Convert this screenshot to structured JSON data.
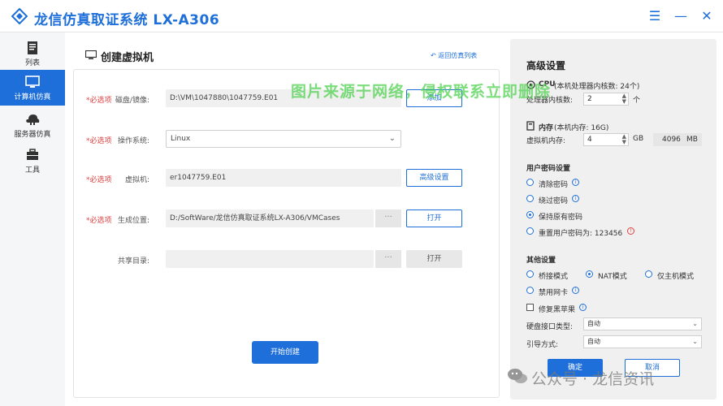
{
  "app": {
    "title": "龙信仿真取证系统 LX-A306"
  },
  "sidebar": {
    "items": [
      {
        "label": "列表",
        "icon": "doc-icon"
      },
      {
        "label": "计算机仿真",
        "icon": "monitor-icon",
        "active": true
      },
      {
        "label": "服务器仿真",
        "icon": "server-icon"
      },
      {
        "label": "工具",
        "icon": "toolbox-icon"
      }
    ]
  },
  "main": {
    "title": "创建虚拟机",
    "back_link": "返回仿真列表",
    "required_tag": "*必选项",
    "rows": {
      "disk": {
        "label": "磁盘/镜像:",
        "value": "D:\\VM\\1047880\\1047759.E01",
        "button": "添加"
      },
      "os": {
        "label": "操作系统:",
        "value": "Linux"
      },
      "vm": {
        "label": "虚拟机:",
        "value": "er1047759.E01",
        "button": "高级设置"
      },
      "location": {
        "label": "生成位置:",
        "value": "D:/SoftWare/龙信仿真取证系统LX-A306/VMCases",
        "dots": "···",
        "button": "打开"
      },
      "share": {
        "label": "共享目录:",
        "value": "",
        "dots": "···",
        "button": "打开"
      }
    },
    "start_button": "开始创建"
  },
  "advanced": {
    "title": "高级设置",
    "cpu": {
      "heading": "CPU",
      "note": "(本机处理器内核数: 24个)",
      "field_label": "处理器内核数:",
      "value": "2",
      "unit": "个"
    },
    "memory": {
      "heading": "内存",
      "note": "(本机内存: 16G)",
      "field_label": "虚拟机内存:",
      "value": "4",
      "unit": "GB",
      "mb_value": "4096",
      "mb_unit": "MB"
    },
    "password": {
      "heading": "用户密码设置",
      "options": [
        "清除密码",
        "绕过密码",
        "保持原有密码",
        "重置用户密码为: 123456"
      ],
      "selected": 2
    },
    "other": {
      "heading": "其他设置",
      "network_options": [
        "桥接模式",
        "NAT模式",
        "仅主机模式",
        "禁用网卡"
      ],
      "selected": 1,
      "bluescreen": "修复黑苹果",
      "disk_iface_label": "硬盘接口类型:",
      "disk_iface_value": "自动",
      "boot_label": "引导方式:",
      "boot_value": "自动"
    },
    "ok_button": "确定",
    "cancel_button": "取消"
  },
  "watermarks": {
    "top": "图片来源于网络，侵权联系立即删除",
    "bottom": "公众号 · 龙信资讯"
  },
  "colors": {
    "accent": "#1e6fd9",
    "required": "#e04040",
    "watermark_green": "#50d250"
  }
}
